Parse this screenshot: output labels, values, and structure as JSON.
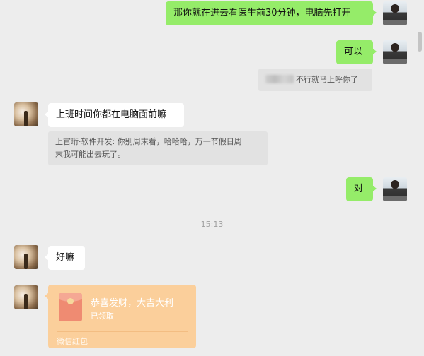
{
  "messages": {
    "m1": "那你就在进去看医生前30分钟，电脑先打开",
    "m2": "可以",
    "m3_quote_text": "不行就马上呼你了",
    "m4": "上班时间你都在电脑面前嘛",
    "m5_quote_line1": "上官珩·软件开发: 你别周末看，哈哈哈，万一节假日周",
    "m5_quote_line2": "末我可能出去玩了。",
    "m6": "对",
    "timestamp": "15:13",
    "m7": "好嘛"
  },
  "red_packet": {
    "title": "恭喜发财，大吉大利",
    "status": "已领取",
    "footer": "微信红包",
    "color": "#fbcf9b"
  },
  "colors": {
    "background": "#ededed",
    "my_bubble": "#95ec69",
    "other_bubble": "#ffffff"
  }
}
